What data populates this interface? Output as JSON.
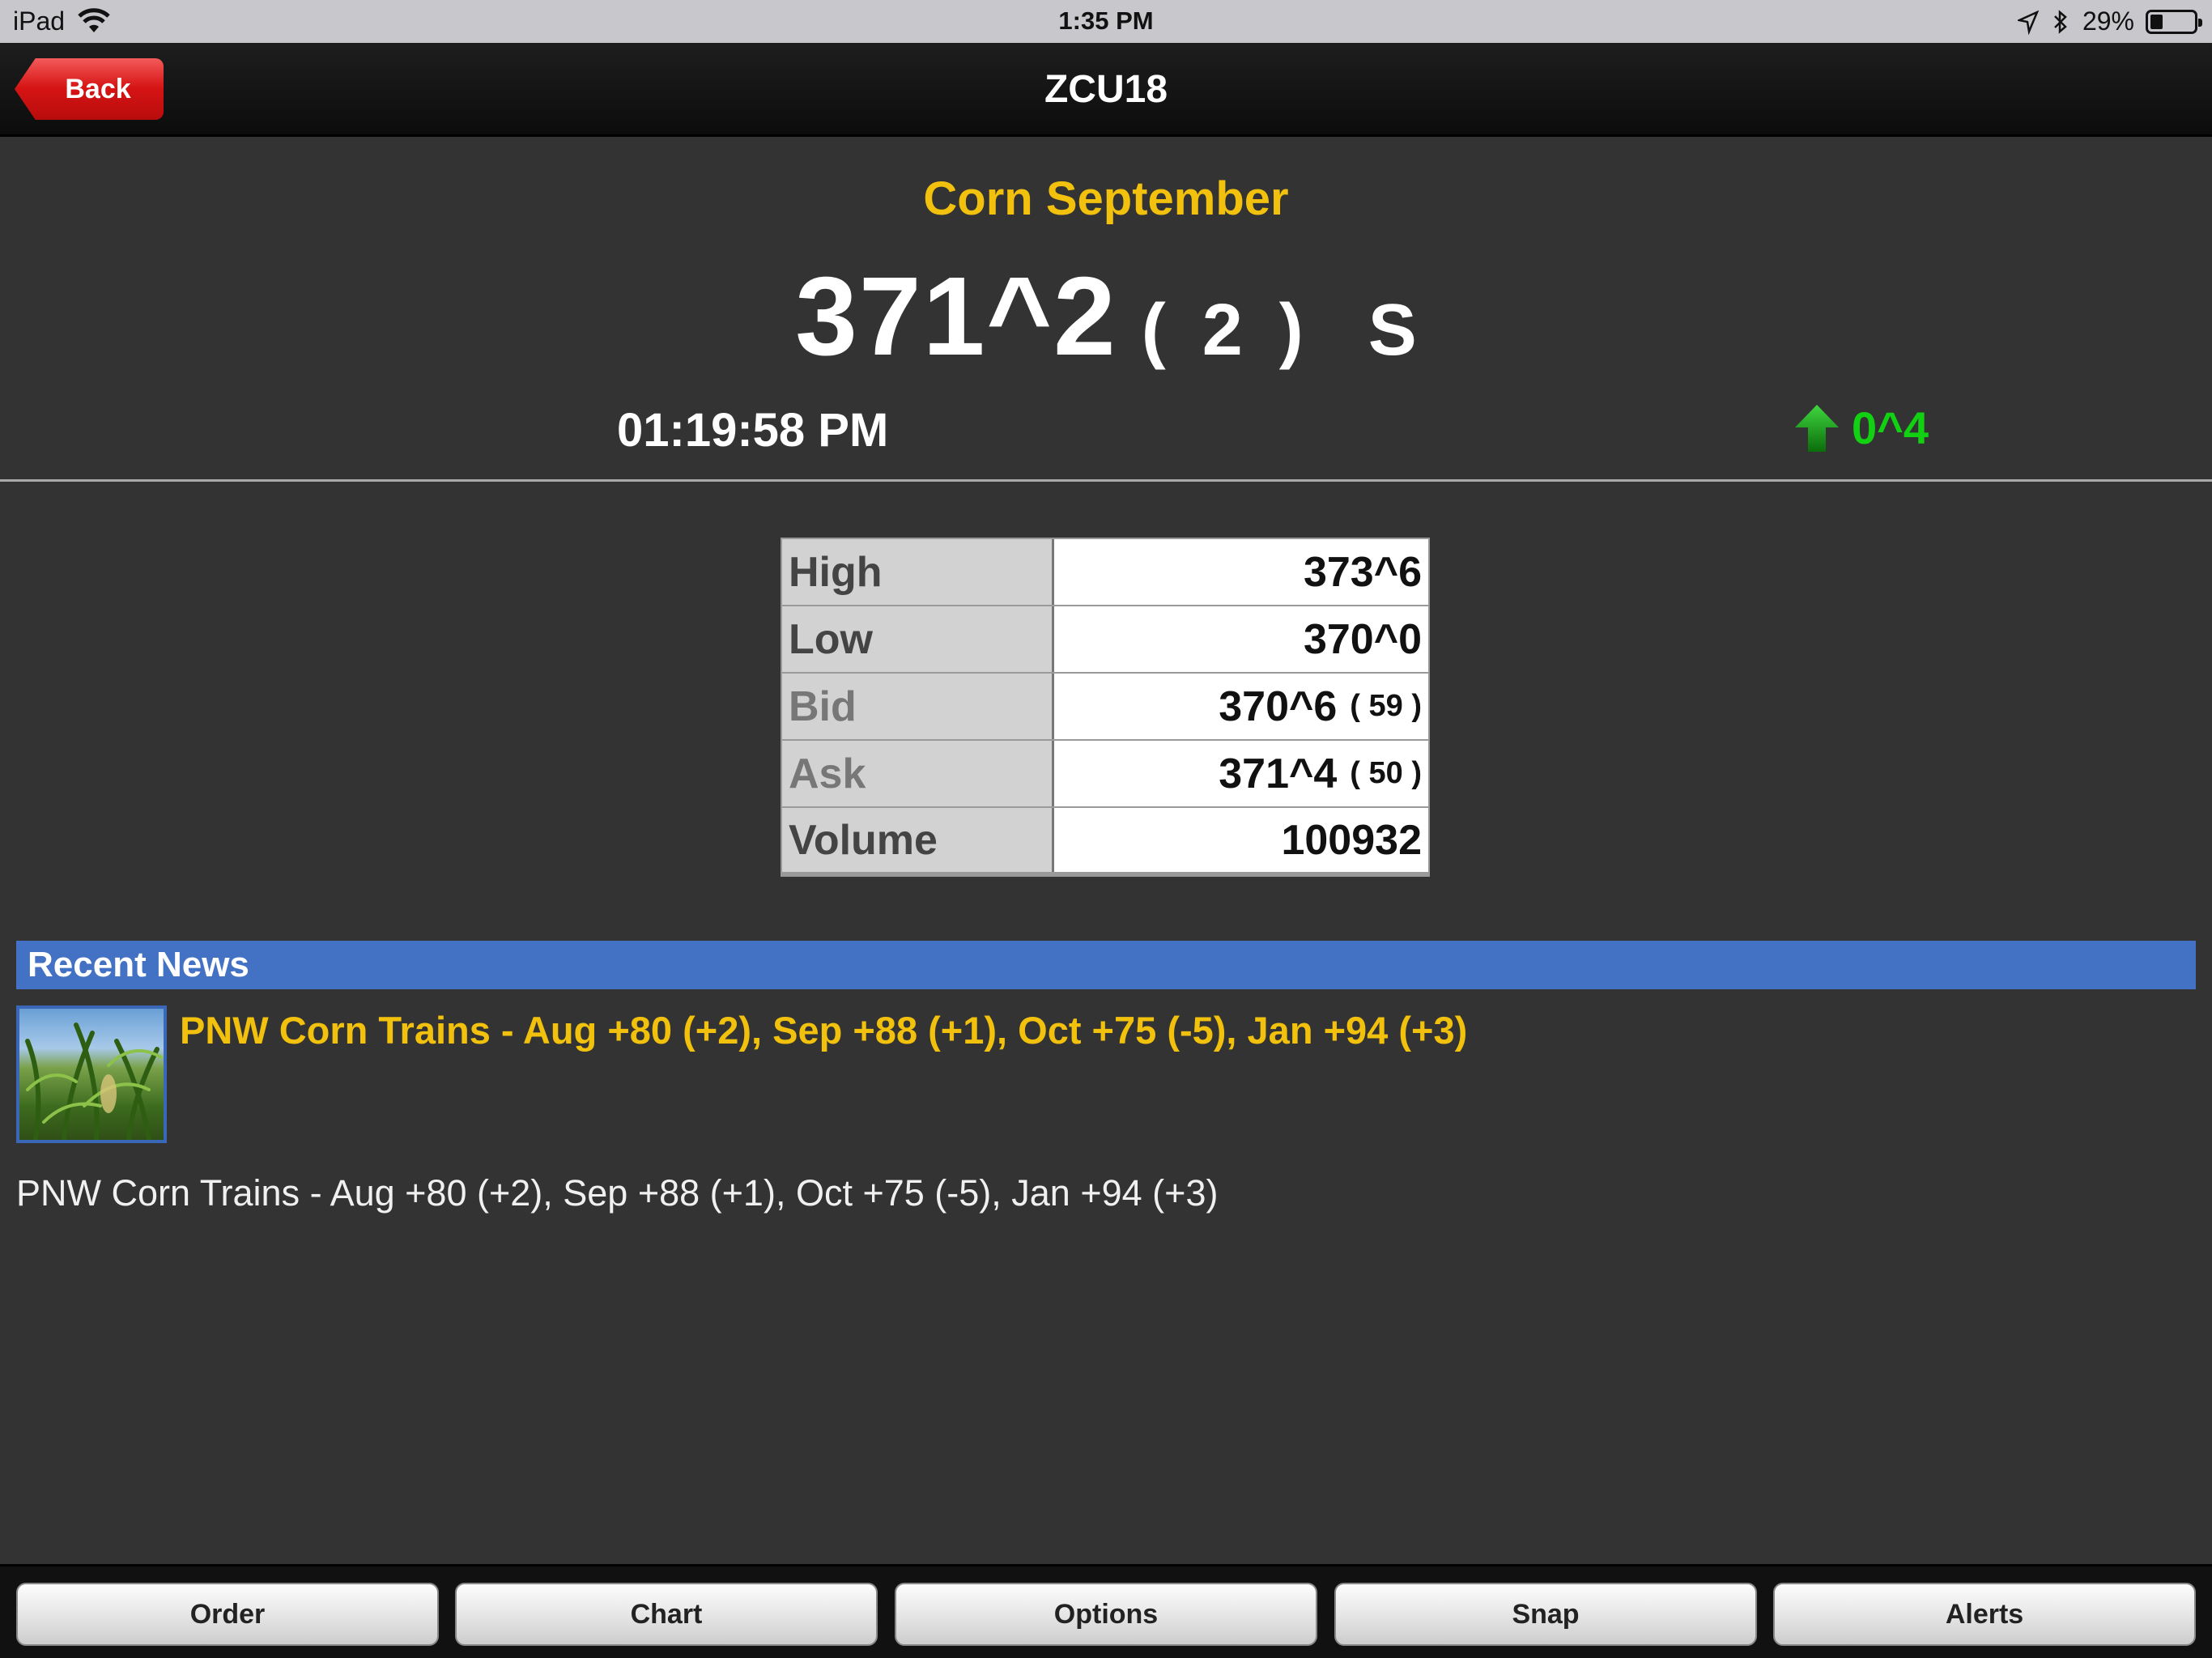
{
  "statusbar": {
    "device": "iPad",
    "time": "1:35 PM",
    "battery": "29%",
    "battery_level": 0.29
  },
  "navbar": {
    "back_label": "Back",
    "title": "ZCU18"
  },
  "quote": {
    "name": "Corn September",
    "price": "371^2",
    "price_sub": "( 2 )",
    "flag": "S",
    "time": "01:19:58 PM",
    "net_change": "0^4",
    "net_change_color": "#12d112",
    "direction_icon": "up-arrow-icon"
  },
  "stats": [
    {
      "label": "High",
      "value": "373^6",
      "size": ""
    },
    {
      "label": "Low",
      "value": "370^0",
      "size": ""
    },
    {
      "label": "Bid",
      "value": "370^6",
      "size": "( 59 )"
    },
    {
      "label": "Ask",
      "value": "371^4",
      "size": "( 50 )"
    },
    {
      "label": "Volume",
      "value": "100932",
      "size": ""
    }
  ],
  "news": {
    "header": "Recent News",
    "thumbnail_icon": "corn-field-image",
    "headline": "PNW Corn Trains - Aug +80 (+2), Sep +88 (+1), Oct +75 (-5), Jan +94 (+3)",
    "body": "PNW Corn Trains - Aug +80 (+2), Sep +88 (+1), Oct +75 (-5), Jan +94 (+3)"
  },
  "toolbar": {
    "order": "Order",
    "chart": "Chart",
    "options": "Options",
    "snap": "Snap",
    "alerts": "Alerts"
  },
  "colors": {
    "background": "#333333",
    "accent_yellow": "#f2c10d",
    "news_header": "#4372c4",
    "back_button": "#d61414"
  }
}
